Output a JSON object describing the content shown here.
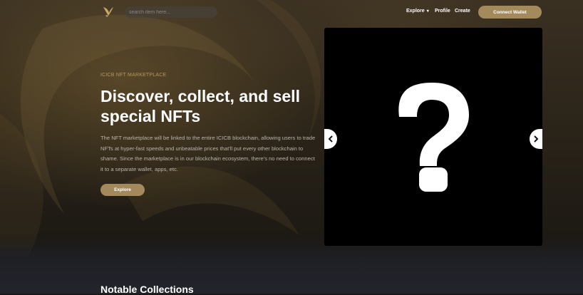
{
  "header": {
    "logo_icon": "bird-logo-icon",
    "search_placeholder": "search item here...",
    "nav": {
      "explore": "Explore",
      "profile": "Profile",
      "create": "Create"
    },
    "connect_wallet": "Connect Wallet"
  },
  "hero": {
    "eyebrow": "ICICB NFT MARKETPLACE",
    "headline": "Discover, collect, and sell special NFTs",
    "description": "The NFT marketplace will be linked to the entire ICICB blockchain, allowing users to trade NFTs at hyper-fast speeds and unbeatable prices that'll put every other blockchain to shame. Since the marketplace is in our blockchain ecosystem, there's no need to connect it to a separate wallet, apps, etc.",
    "explore_button": "Explore"
  },
  "carousel": {
    "image_icon": "question-mark-icon",
    "prev_icon": "chevron-left-icon",
    "next_icon": "chevron-right-icon"
  },
  "notable": {
    "title": "Notable Collections"
  },
  "colors": {
    "accent": "#a38a5c",
    "eyebrow": "#b39864",
    "background": "#1b1a19"
  }
}
